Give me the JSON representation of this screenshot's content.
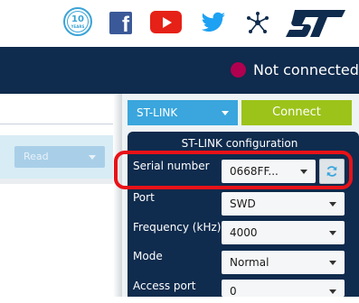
{
  "top_icons": {
    "badge_number": "10",
    "badge_text": "YEARS",
    "facebook_letter": "f"
  },
  "header": {
    "status_text": "Not connected",
    "status_color": "#b0004f"
  },
  "left_panel": {
    "read_button_label": "Read"
  },
  "right_panel": {
    "interface_select": "ST-LINK",
    "connect_label": "Connect",
    "config": {
      "title": "ST-LINK configuration",
      "serial_number_label": "Serial number",
      "serial_number_value": "0668FF...",
      "port_label": "Port",
      "port_value": "SWD",
      "frequency_label": "Frequency (kHz)",
      "frequency_value": "4000",
      "mode_label": "Mode",
      "mode_value": "Normal",
      "access_port_label": "Access port",
      "access_port_value": "0"
    }
  },
  "colors": {
    "header_bg": "#0f2b4d",
    "stlink_blue": "#3aa6dd",
    "connect_green": "#9cc319",
    "highlight_red": "#e81218"
  }
}
